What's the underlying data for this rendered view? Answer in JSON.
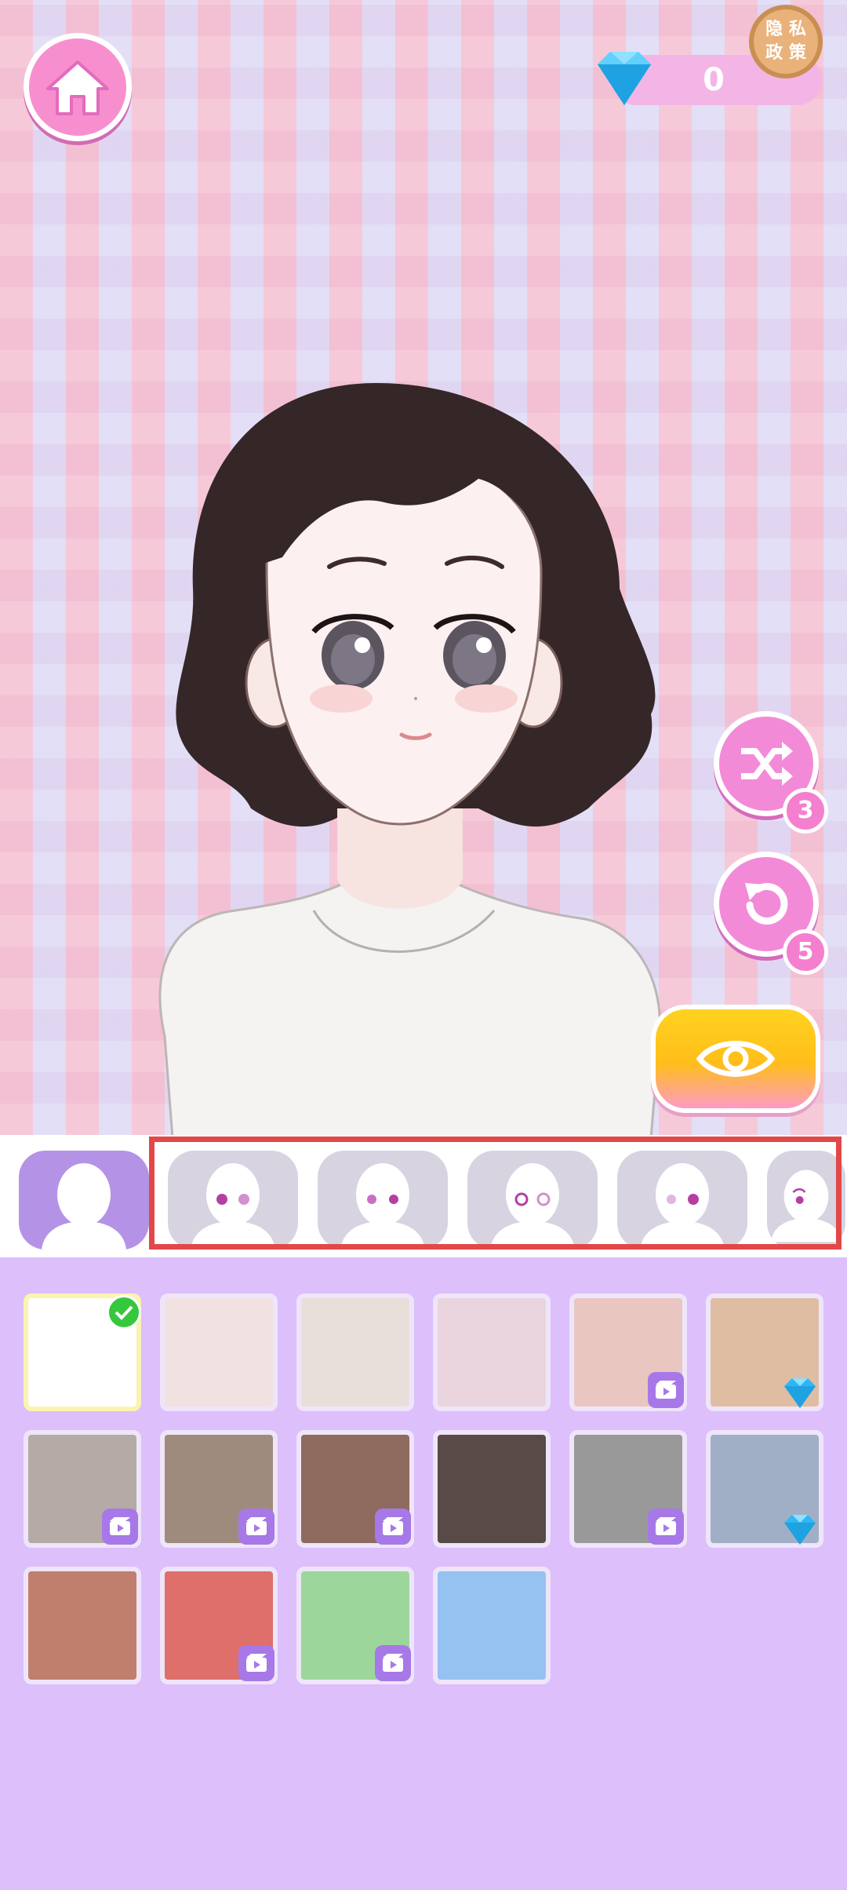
{
  "header": {
    "gem_count": "0",
    "privacy_line1": "隐 私",
    "privacy_line2": "政 策"
  },
  "buttons": {
    "shuffle_count": "3",
    "undo_count": "5"
  },
  "face_tabs": [
    {
      "icon": "blank-face-icon",
      "selected": true
    },
    {
      "icon": "face-eyes-style-1-icon",
      "selected": false
    },
    {
      "icon": "face-eyes-style-2-icon",
      "selected": false
    },
    {
      "icon": "face-eyes-style-3-icon",
      "selected": false
    },
    {
      "icon": "face-eyes-style-4-icon",
      "selected": false
    },
    {
      "icon": "face-eyes-style-5-icon",
      "selected": false
    }
  ],
  "colors": {
    "accent_pink": "#f78fcf",
    "highlight_red": "#e24848",
    "panel_purple": "#dcbffb",
    "selected_tab": "#b493e6"
  },
  "swatches": [
    {
      "color": "#ffffff",
      "badge": "check"
    },
    {
      "color": "#f1e1e1",
      "badge": "none"
    },
    {
      "color": "#e8dfdb",
      "badge": "none"
    },
    {
      "color": "#ead5de",
      "badge": "none"
    },
    {
      "color": "#e9c7c0",
      "badge": "video"
    },
    {
      "color": "#dfbda3",
      "badge": "gem"
    },
    {
      "color": "#b5aaa6",
      "badge": "video"
    },
    {
      "color": "#9f8b7d",
      "badge": "video"
    },
    {
      "color": "#8f6a5f",
      "badge": "video"
    },
    {
      "color": "#574a47",
      "badge": "none"
    },
    {
      "color": "#999999",
      "badge": "video"
    },
    {
      "color": "#a0afc5",
      "badge": "gem"
    },
    {
      "color": "#c07f6c",
      "badge": "none"
    },
    {
      "color": "#de6f6a",
      "badge": "video"
    },
    {
      "color": "#9dd69b",
      "badge": "video"
    },
    {
      "color": "#95c2f1",
      "badge": "none"
    }
  ]
}
